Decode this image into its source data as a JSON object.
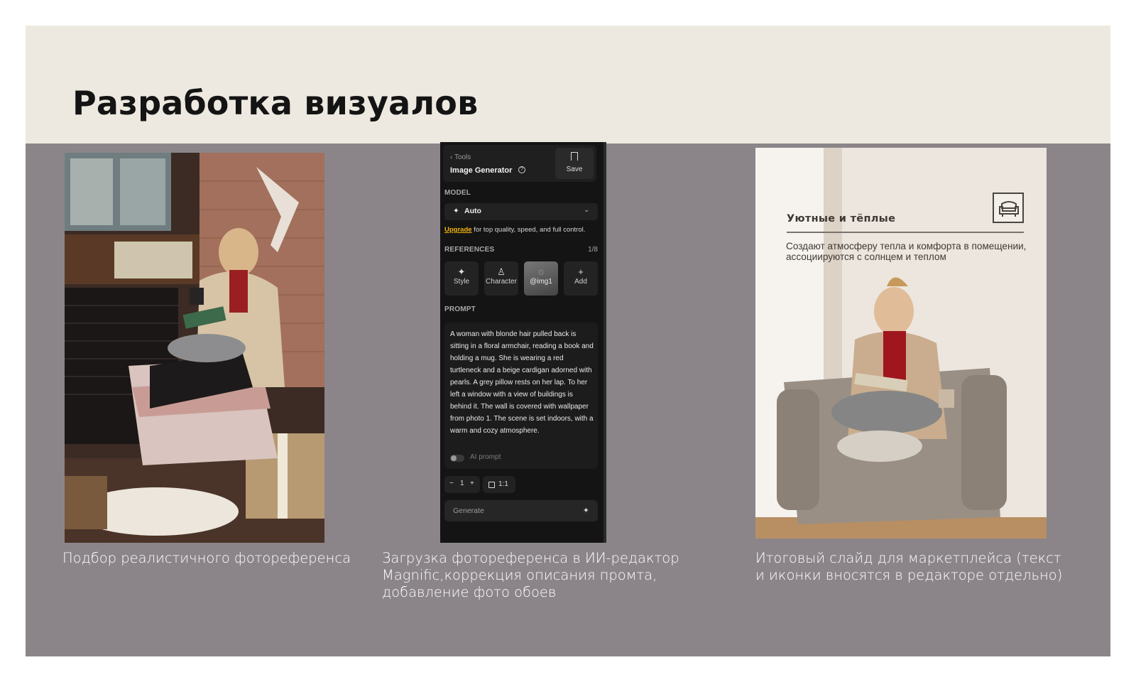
{
  "slide": {
    "title": "Разработка визуалов"
  },
  "steps": [
    {
      "caption": "Подбор реалистичного фотореференса"
    },
    {
      "caption": "Загрузка фотореференса в ИИ-редактор Magnific,коррекция описания промта, добавление фото обоев"
    },
    {
      "caption": "Итоговый слайд для маркетплейса (текст и иконки вносятся в редакторе отдельно)"
    }
  ],
  "ui_panel": {
    "back_label": "Tools",
    "title": "Image Generator",
    "help_glyph": "?",
    "save_label": "Save",
    "model_section": "MODEL",
    "model_value": "Auto",
    "upgrade_link": "Upgrade",
    "upgrade_text": " for top quality, speed, and full control.",
    "references_section": "REFERENCES",
    "references_count": "1/8",
    "references": [
      {
        "label": "Style",
        "icon": "style-icon",
        "glyph": "✦"
      },
      {
        "label": "Character",
        "icon": "character-icon",
        "glyph": "♙"
      },
      {
        "label": "@img1",
        "icon": "image-reference",
        "glyph": "◌"
      },
      {
        "label": "Add",
        "icon": "plus-icon",
        "glyph": "+"
      }
    ],
    "prompt_section": "PROMPT",
    "prompt_text": "A woman with blonde hair pulled back is sitting in a floral armchair, reading a book and holding a mug. She is wearing a red turtleneck and a beige cardigan adorned with pearls. A grey pillow rests on her lap. To her left a window with a view of buildings is behind it. The wall is covered with wallpaper from photo 1. The scene is set indoors, with a warm and cozy atmosphere.",
    "ai_prompt_label": "AI prompt",
    "count_minus": "−",
    "count_value": "1",
    "count_plus": "+",
    "ratio_value": "1:1",
    "generate_label": "Generate"
  },
  "final_slide": {
    "heading": "Уютные и тёплые",
    "description": "Создают атмосферу тепла и комфорта в помещении, ассоциируются с солнцем и теплом",
    "badge_icon": "armchair-icon"
  },
  "colors": {
    "header_bg": "#ede9e0",
    "content_bg": "#8b8589",
    "upgrade_accent": "#f5b40a"
  }
}
